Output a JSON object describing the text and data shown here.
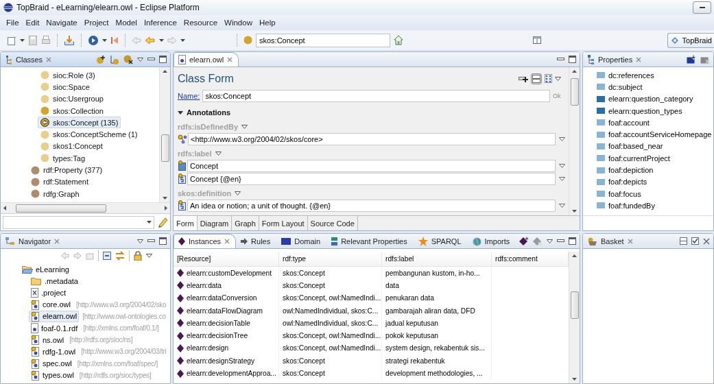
{
  "window": {
    "title": "TopBraid - eLearning/elearn.owl - Eclipse Platform"
  },
  "menu": [
    "File",
    "Edit",
    "Navigate",
    "Project",
    "Model",
    "Inference",
    "Resource",
    "Window",
    "Help"
  ],
  "toolbar": {
    "search_value": "skos:Concept",
    "perspective": "TopBraid"
  },
  "classes": {
    "tab": "Classes",
    "items": [
      {
        "children": [
          {
            "label": "sioc:Role  (3)",
            "color": "#e8d08c",
            "selected": false
          },
          {
            "label": "sioc:Space",
            "color": "#e8d08c",
            "selected": false
          },
          {
            "label": "sioc:Usergroup",
            "color": "#e8d08c",
            "selected": false
          },
          {
            "label": "skos:Collection",
            "color": "#d4a52a",
            "selected": false
          },
          {
            "label": "skos:Concept  (135)",
            "color": "#d4a52a",
            "selected": true
          },
          {
            "label": "skos:ConceptScheme  (1)",
            "color": "#e8d08c",
            "selected": false
          },
          {
            "label": "skos1:Concept",
            "color": "#e8d08c",
            "selected": false
          },
          {
            "label": "types:Tag",
            "color": "#e8d08c",
            "selected": false
          }
        ]
      },
      {
        "label": "rdf:Property  (377)",
        "color": "#b08c6c",
        "selected": false
      },
      {
        "label": "rdf:Statement",
        "color": "#b08c6c",
        "selected": false
      },
      {
        "label": "rdfg:Graph",
        "color": "#b08c6c",
        "selected": false
      }
    ]
  },
  "navigator": {
    "tab": "Navigator",
    "tree": [
      {
        "label": "eLearning",
        "kind": "folder",
        "expanded": true,
        "selected": false,
        "children": [
          {
            "label": ".metadata",
            "kind": "folder",
            "expanded": false,
            "selected": false
          },
          {
            "label": ".project",
            "kind": "file",
            "selected": false
          },
          {
            "label": "core.owl",
            "uri": "[http://www.w3.org/2004/02/sko",
            "kind": "ontology",
            "selected": false
          },
          {
            "label": "elearn.owl",
            "uri": "[http://www.owl-ontologies.co",
            "kind": "ontology",
            "selected": true
          },
          {
            "label": "foaf-0.1.rdf",
            "uri": "[http://xmlns.com/foaf/0.1/]",
            "kind": "document",
            "selected": false
          },
          {
            "label": "ns.owl",
            "uri": "[http://rdfs.org/sioc/ns]",
            "kind": "ontology",
            "selected": false
          },
          {
            "label": "rdfg-1.owl",
            "uri": "[http://www.w3.org/2004/03/tri",
            "kind": "ontology",
            "selected": false
          },
          {
            "label": "spec.owl",
            "uri": "[http://xmlns.com/foaf/spec/]",
            "kind": "ontology",
            "selected": false
          },
          {
            "label": "types.owl",
            "uri": "[http://rdfs.org/sioc/types]",
            "kind": "ontology",
            "selected": false
          }
        ]
      }
    ]
  },
  "editor": {
    "tab": "elearn.owl",
    "title": "Class Form",
    "name_label": "Name:",
    "name_value": "skos:Concept",
    "ok": {
      "label": "Ok",
      "disabled": true
    },
    "section": {
      "title": "Annotations",
      "expanded": true
    },
    "properties": [
      {
        "name": "rdfs:isDefinedBy",
        "values": [
          {
            "kind": "resource",
            "text": "<http://www.w3.org/2004/02/skos/core>"
          }
        ]
      },
      {
        "name": "rdfs:label",
        "values": [
          {
            "kind": "string",
            "text": "Concept"
          },
          {
            "kind": "langstring",
            "text": "Concept {@en}"
          }
        ]
      },
      {
        "name": "skos:definition",
        "values": [
          {
            "kind": "langstring",
            "text": "An idea or notion; a unit of thought. {@en}"
          }
        ]
      }
    ],
    "bottom_tabs": [
      {
        "label": "Form",
        "selected": true
      },
      {
        "label": "Diagram",
        "selected": false
      },
      {
        "label": "Graph",
        "selected": false
      },
      {
        "label": "Form Layout",
        "selected": false
      },
      {
        "label": "Source Code",
        "selected": false
      }
    ]
  },
  "properties": {
    "tab": "Properties",
    "items": [
      {
        "label": "dc:references",
        "color": "#8ab4d4"
      },
      {
        "label": "dc:subject",
        "color": "#8ab4d4"
      },
      {
        "label": "elearn:question_category",
        "color": "#2a6ea6"
      },
      {
        "label": "elearn:question_types",
        "color": "#2a6ea6"
      },
      {
        "label": "foaf:account",
        "color": "#8ab4d4"
      },
      {
        "label": "foaf:accountServiceHomepage",
        "color": "#8ab4d4"
      },
      {
        "label": "foaf:based_near",
        "color": "#8ab4d4"
      },
      {
        "label": "foaf:currentProject",
        "color": "#8ab4d4"
      },
      {
        "label": "foaf:depiction",
        "color": "#8ab4d4"
      },
      {
        "label": "foaf:depicts",
        "color": "#8ab4d4"
      },
      {
        "label": "foaf:focus",
        "color": "#8ab4d4"
      },
      {
        "label": "foaf:fundedBy",
        "color": "#8ab4d4"
      }
    ]
  },
  "instances": {
    "tabs": [
      {
        "label": "Instances",
        "kind": "instances",
        "selected": true
      },
      {
        "label": "Rules",
        "kind": "rules",
        "selected": false
      },
      {
        "label": "Domain",
        "kind": "domain",
        "selected": false
      },
      {
        "label": "Relevant Properties",
        "kind": "properties",
        "selected": false
      },
      {
        "label": "SPARQL",
        "kind": "sparql",
        "selected": false
      },
      {
        "label": "Imports",
        "kind": "imports",
        "selected": false
      }
    ],
    "columns": [
      "[Resource]",
      "rdf:type",
      "rdfs:label",
      "rdfs:comment"
    ],
    "rows": [
      {
        "resource": "elearn:customDevelopment",
        "type": "skos:Concept",
        "label": "pembangunan kustom, in-ho..."
      },
      {
        "resource": "elearn:data",
        "type": "skos:Concept",
        "label": "data"
      },
      {
        "resource": "elearn:dataConversion",
        "type": "skos:Concept, owl:NamedIndi...",
        "label": "penukaran data"
      },
      {
        "resource": "elearn:dataFlowDiagram",
        "type": "owl:NamedIndividual, skos:C...",
        "label": "gambarajah aliran data, DFD"
      },
      {
        "resource": "elearn:decisionTable",
        "type": "owl:NamedIndividual, skos:C...",
        "label": "jadual keputusan"
      },
      {
        "resource": "elearn:decisionTree",
        "type": "skos:Concept, owl:NamedIndi...",
        "label": "pokok keputusan"
      },
      {
        "resource": "elearn:design",
        "type": "skos:Concept, owl:NamedIndi...",
        "label": "system design, rekabentuk sis..."
      },
      {
        "resource": "elearn:designStrategy",
        "type": "skos:Concept",
        "label": "strategi rekabentuk"
      },
      {
        "resource": "elearn:developmentApproa...",
        "type": "skos:Concept",
        "label": "development methodologies, ..."
      }
    ]
  },
  "basket": {
    "tab": "Basket"
  }
}
